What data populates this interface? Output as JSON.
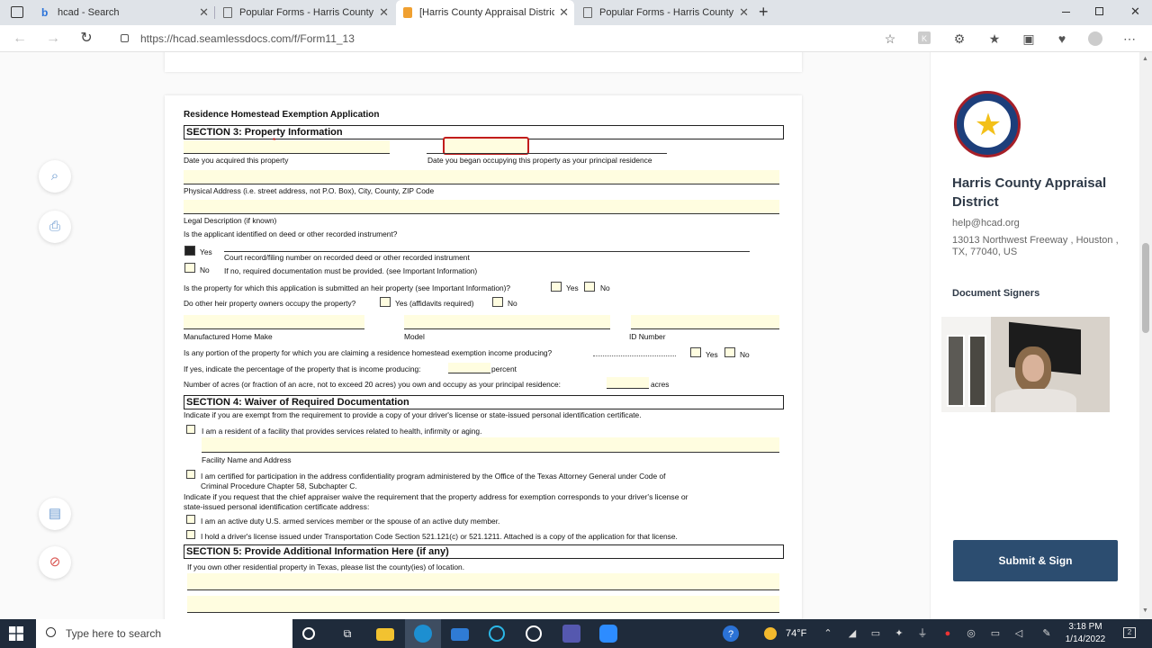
{
  "browser": {
    "tabs": [
      {
        "label": "hcad - Search",
        "icon": "bing-icon"
      },
      {
        "label": "Popular Forms - Harris County A",
        "icon": "page-icon"
      },
      {
        "label": "[Harris County Appraisal District",
        "icon": "doc-icon",
        "active": true
      },
      {
        "label": "Popular Forms - Harris County A",
        "icon": "page-icon"
      }
    ],
    "new_tab": "+",
    "url": "https://hcad.seamlessdocs.com/f/Form11_13"
  },
  "form": {
    "header": "Residence Homestead Exemption Application",
    "section3": {
      "title": "SECTION 3: Property Information",
      "date_acquired": "Date you acquired this property",
      "date_occupied": "Date you began occupying this property as your principal residence",
      "physical_address": "Physical Address (i.e. street address, not P.O. Box), City, County, ZIP Code",
      "legal_description": "Legal Description (if known)",
      "heir_question": "Is the applicant identified on deed or other recorded instrument?",
      "yes": "Yes",
      "no": "No",
      "court_record": "Court record/filing number on recorded deed or other recorded instrument",
      "if_no": "If no, required documentation must be provided. (see Important Information)",
      "heir_property": "Is the property for which this application is submitted an heir property (see Important Information)?",
      "other_heirs": "Do other heir property owners occupy the property?",
      "yes_affidavits": "Yes (affidavits required)",
      "manufactured": "Manufactured Home Make",
      "model": "Model",
      "id_number": "ID Number",
      "income_producing": "Is any portion of the property for which you are claiming a residence homestead exemption income producing?",
      "percentage": "If yes, indicate the percentage of the property that is income producing:",
      "percent": "percent",
      "acres_q": "Number of acres (or fraction of an acre, not to exceed 20 acres) you own and occupy as your principal residence:",
      "acres": "acres"
    },
    "section4": {
      "title": "SECTION 4: Waiver of Required Documentation",
      "intro": "Indicate if you are exempt from the requirement to provide a copy of your driver's license or state-issued personal identification certificate.",
      "facility": "I am a resident of a facility that provides services related to health, infirmity or aging.",
      "facility_name": "Facility Name and Address",
      "certified_1": "I am certified for participation in the address confidentiality program administered by the Office of the Texas Attorney General under Code of",
      "certified_2": "Criminal Procedure Chapter 58, Subchapter C.",
      "waive_1": "Indicate if you request that the chief appraiser waive the requirement that the property address for exemption corresponds to your driver's license or",
      "waive_2": "state-issued personal identification certificate address:",
      "military": "I am an active duty U.S. armed services member or the spouse of an active duty member.",
      "license": "I hold a driver's license issued under Transportation Code Section 521.121(c) or 521.1211. Attached is a copy of the application for that license."
    },
    "section5": {
      "title": "SECTION 5: Provide Additional Information Here (if any)",
      "intro": "If you own other residential property in Texas, please list the county(ies) of location."
    }
  },
  "panel": {
    "org_name": "Harris County Appraisal District",
    "email": "help@hcad.org",
    "address": "13013 Northwest Freeway , Houston , TX, 77040, US",
    "signers_heading": "Document Signers",
    "submit": "Submit & Sign",
    "logo_text": "HARRIS COUNTY APPRAISAL DISTRICT"
  },
  "taskbar": {
    "search_placeholder": "Type here to search",
    "temperature": "74°F",
    "time": "3:18 PM",
    "date": "1/14/2022",
    "notifications": "2"
  }
}
